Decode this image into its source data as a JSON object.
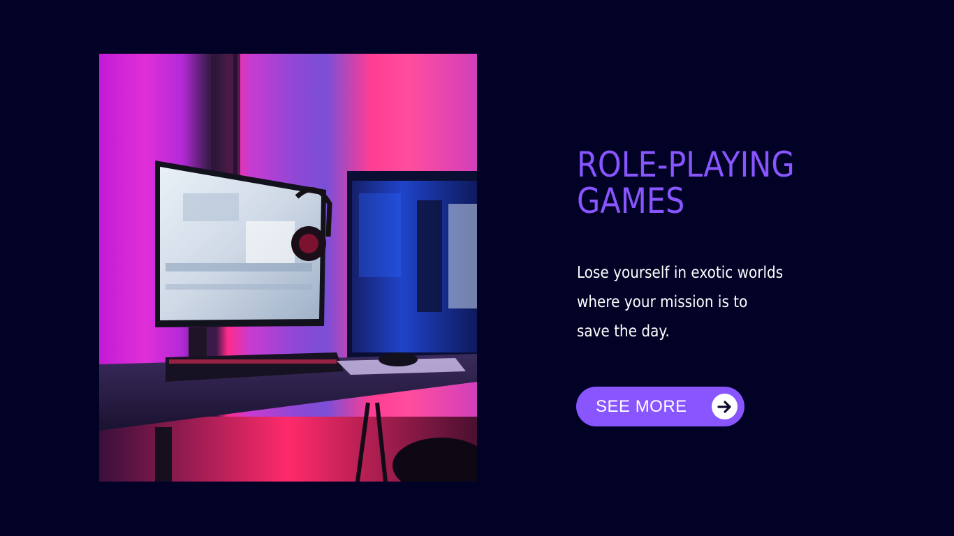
{
  "hero": {
    "title": "ROLE-PLAYING\nGAMES",
    "description": "Lose yourself in exotic worlds\nwhere your mission is to\nsave the day.",
    "cta_label": "SEE MORE",
    "photo_icon": "gaming-setup-photo",
    "cta_icon": "arrow-right-icon"
  },
  "colors": {
    "background": "#020226",
    "accent": "#8855ff",
    "text": "#ffffff"
  }
}
